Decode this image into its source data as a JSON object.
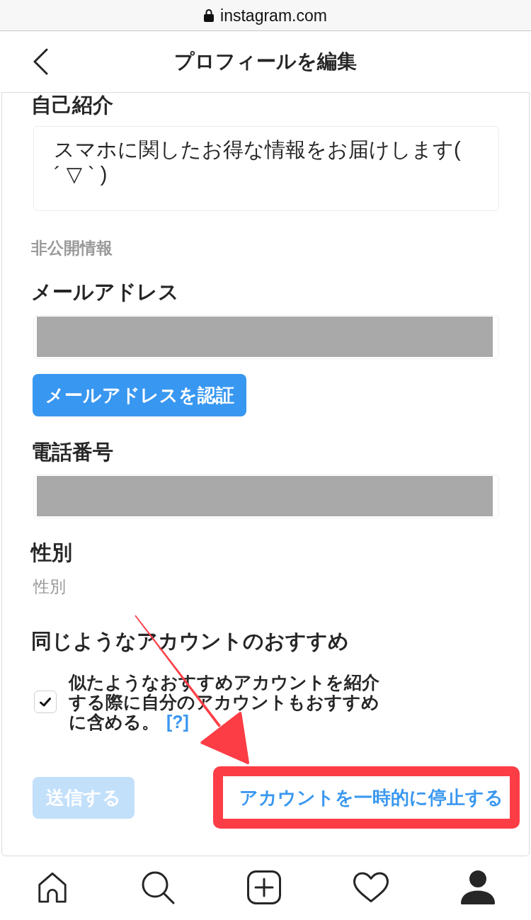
{
  "browser": {
    "url": "instagram.com"
  },
  "header": {
    "title": "プロフィールを編集"
  },
  "bio": {
    "label": "自己紹介",
    "value": "スマホに関したお得な情報をお届けします( ´ ▽ ` )"
  },
  "private_section": {
    "heading": "非公開情報"
  },
  "email": {
    "label": "メールアドレス",
    "redacted": true,
    "verify_button": "メールアドレスを認証"
  },
  "phone": {
    "label": "電話番号",
    "redacted": true
  },
  "gender": {
    "label": "性別",
    "placeholder": "性別"
  },
  "recommend": {
    "heading": "同じようなアカウントのおすすめ",
    "checked": true,
    "text": "似たようなおすすめアカウントを紹介する際に自分のアカウントもおすすめに含める。",
    "help_link": "[?]"
  },
  "actions": {
    "submit": {
      "label": "送信する",
      "disabled": true
    },
    "deactivate": {
      "label": "アカウントを一時的に停止する",
      "highlighted": true
    }
  },
  "bottom_nav": [
    {
      "kind": "home",
      "selected": false
    },
    {
      "kind": "search",
      "selected": false
    },
    {
      "kind": "new_post",
      "selected": false
    },
    {
      "kind": "activity",
      "selected": false
    },
    {
      "kind": "profile",
      "selected": true
    }
  ]
}
